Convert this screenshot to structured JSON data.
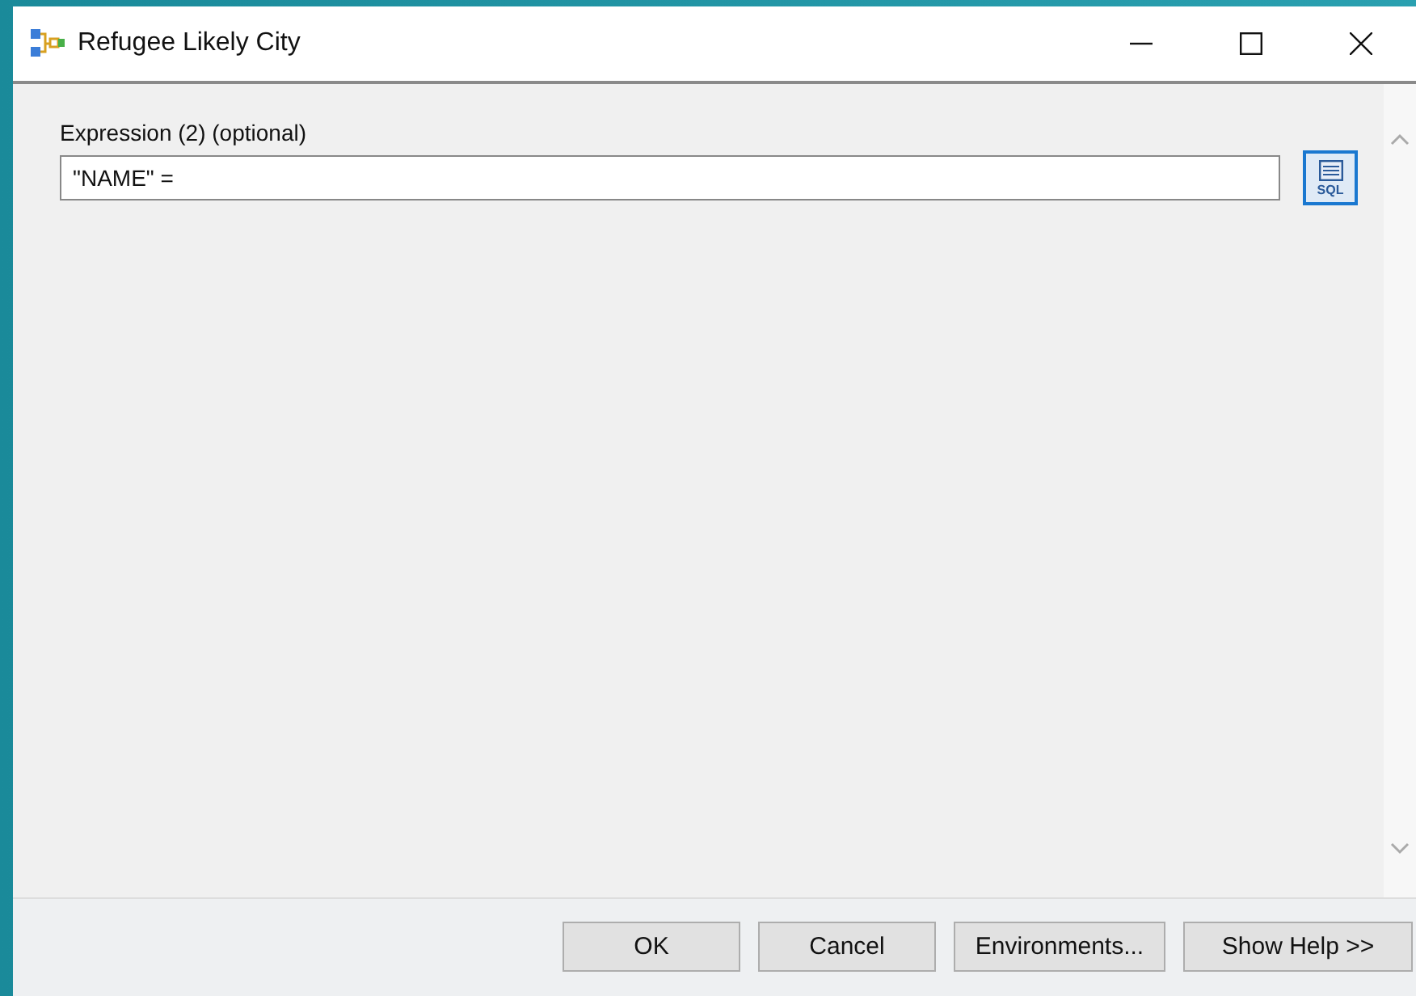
{
  "window": {
    "title": "Refugee Likely City"
  },
  "parameter": {
    "label": "Expression (2) (optional)",
    "value": "\"NAME\" =",
    "sql_button": "SQL"
  },
  "buttons": [
    {
      "label": "OK"
    },
    {
      "label": "Cancel"
    },
    {
      "label": "Environments..."
    },
    {
      "label": "Show Help >>"
    }
  ]
}
